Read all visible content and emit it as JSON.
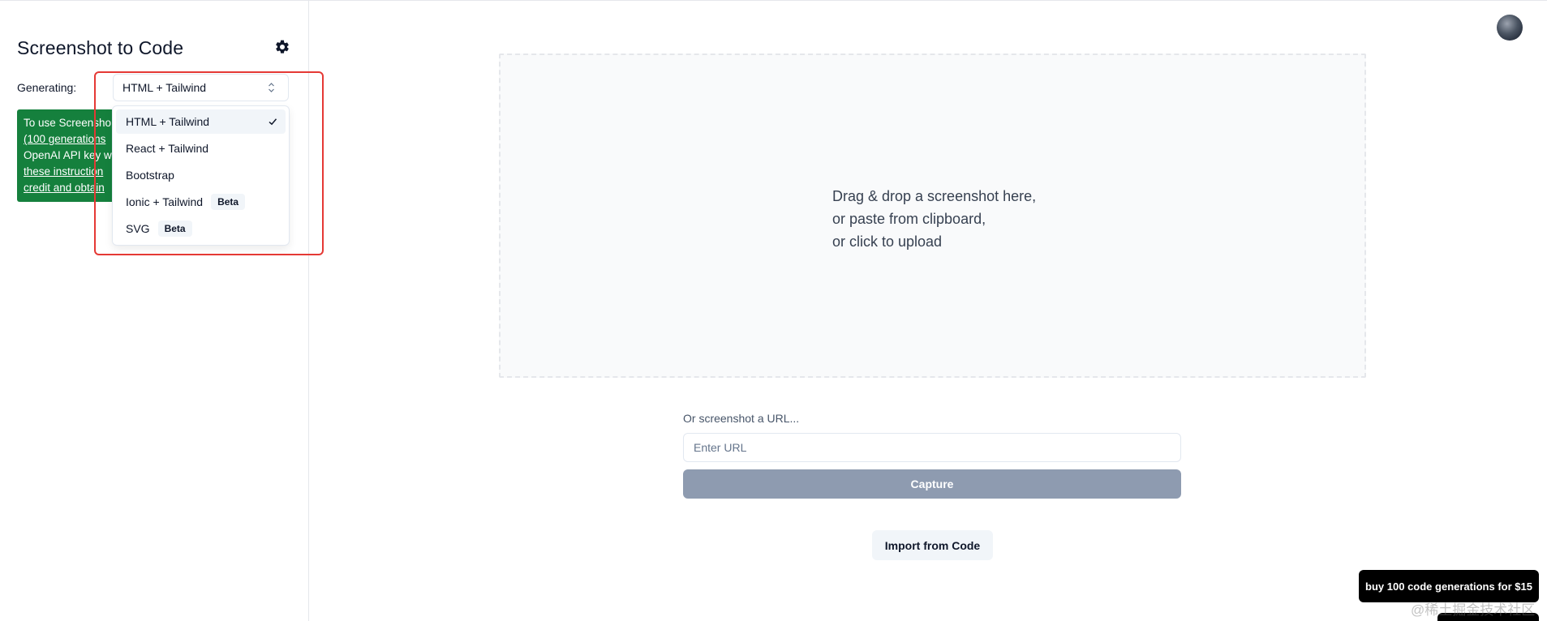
{
  "sidebar": {
    "title": "Screenshot to Code",
    "generating_label": "Generating:",
    "selected_stack": "HTML + Tailwind",
    "notice": {
      "line1": "To use Screensho",
      "line2": "(100 generations",
      "line3": "OpenAI API key w",
      "line4": "these instruction",
      "line5": "credit and obtain"
    }
  },
  "dropdown": {
    "options": [
      {
        "label": "HTML + Tailwind",
        "badge": "",
        "selected": true
      },
      {
        "label": "React + Tailwind",
        "badge": "",
        "selected": false
      },
      {
        "label": "Bootstrap",
        "badge": "",
        "selected": false
      },
      {
        "label": "Ionic + Tailwind",
        "badge": "Beta",
        "selected": false
      },
      {
        "label": "SVG",
        "badge": "Beta",
        "selected": false
      }
    ]
  },
  "main": {
    "drop_line1": "Drag & drop a screenshot here,",
    "drop_line2": "or paste from clipboard,",
    "drop_line3": "or click to upload",
    "url_label": "Or screenshot a URL...",
    "url_placeholder": "Enter URL",
    "capture_label": "Capture",
    "import_label": "Import from Code",
    "buy_label": "buy 100 code generations for $15"
  },
  "overlay": {
    "watermark": "@稀土掘金技术社区"
  },
  "colors": {
    "notice_bg": "#15803d",
    "highlight": "#e53935",
    "capture_bg": "#8e9bb0"
  }
}
